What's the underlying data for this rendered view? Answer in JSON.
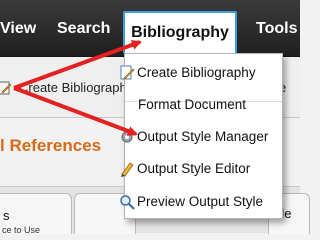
{
  "menubar": {
    "items": [
      {
        "label": "View"
      },
      {
        "label": "Search"
      },
      {
        "label": "Bibliography"
      },
      {
        "label": "Tools"
      }
    ]
  },
  "toolbar": {
    "create_label": "Create Bibliography",
    "right_fragment": "e"
  },
  "section_title": "l References",
  "dropdown": {
    "items": [
      {
        "label": "Create Bibliography",
        "icon": "document-pencil-icon"
      },
      {
        "label": "Format Document",
        "icon": ""
      },
      {
        "label": "Output Style Manager",
        "icon": "gear-icon"
      },
      {
        "label": "Output Style Editor",
        "icon": "pencil-icon"
      },
      {
        "label": "Preview Output Style",
        "icon": "magnifier-icon"
      }
    ]
  },
  "tabs": [
    {
      "label": "s"
    },
    {
      "label": ""
    },
    {
      "label": "de"
    }
  ],
  "footer_note": "ce to Use",
  "colors": {
    "menubar": "#2b2b2b",
    "menu_highlight_border": "#3aa0d8",
    "annotation_arrow": "#e52020",
    "section_title": "#d86a1a"
  }
}
